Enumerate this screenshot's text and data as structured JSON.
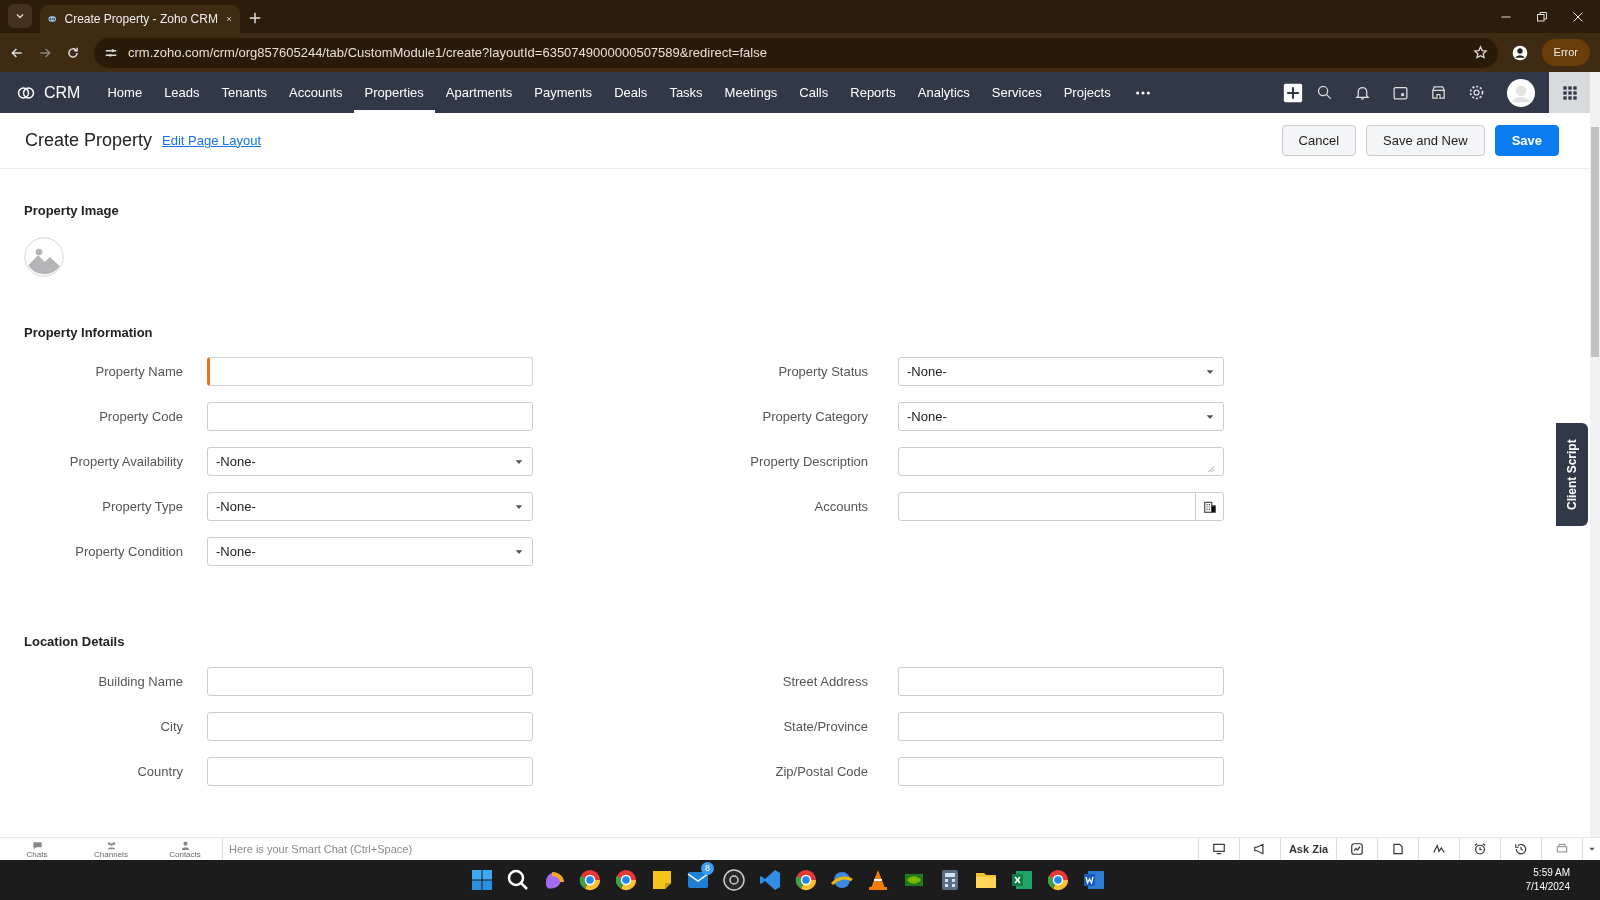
{
  "browser": {
    "tab_title": "Create Property - Zoho CRM",
    "url": "crm.zoho.com/crm/org857605244/tab/CustomModule1/create?layoutId=6350749000000507589&redirect=false",
    "profile_button": "Error"
  },
  "app_nav": {
    "brand": "CRM",
    "items": [
      {
        "label": "Home",
        "selected": false
      },
      {
        "label": "Leads",
        "selected": false
      },
      {
        "label": "Tenants",
        "selected": false
      },
      {
        "label": "Accounts",
        "selected": false
      },
      {
        "label": "Properties",
        "selected": true
      },
      {
        "label": "Apartments",
        "selected": false
      },
      {
        "label": "Payments",
        "selected": false
      },
      {
        "label": "Deals",
        "selected": false
      },
      {
        "label": "Tasks",
        "selected": false
      },
      {
        "label": "Meetings",
        "selected": false
      },
      {
        "label": "Calls",
        "selected": false
      },
      {
        "label": "Reports",
        "selected": false
      },
      {
        "label": "Analytics",
        "selected": false
      },
      {
        "label": "Services",
        "selected": false
      },
      {
        "label": "Projects",
        "selected": false
      }
    ]
  },
  "header": {
    "title": "Create Property",
    "link": "Edit Page Layout",
    "buttons": [
      {
        "label": "Cancel",
        "kind": "secondary"
      },
      {
        "label": "Save and New",
        "kind": "secondary"
      },
      {
        "label": "Save",
        "kind": "primary"
      }
    ]
  },
  "sections": [
    {
      "title": "Property Image",
      "kind": "image"
    },
    {
      "title": "Property Information",
      "kind": "fields",
      "left": [
        {
          "label": "Property Name",
          "kind": "text",
          "focused": true
        },
        {
          "label": "Property Code",
          "kind": "text",
          "focused": false
        },
        {
          "label": "Property Availability",
          "kind": "select",
          "value": "-None-",
          "focused": false
        },
        {
          "label": "Property Type",
          "kind": "select",
          "value": "-None-",
          "focused": false
        },
        {
          "label": "Property Condition",
          "kind": "select",
          "value": "-None-",
          "focused": false
        }
      ],
      "right": [
        {
          "label": "Property Status",
          "kind": "select",
          "value": "-None-",
          "focused": false
        },
        {
          "label": "Property Category",
          "kind": "select",
          "value": "-None-",
          "focused": false
        },
        {
          "label": "Property Description",
          "kind": "textarea",
          "focused": false
        },
        {
          "label": "Accounts",
          "kind": "lookup",
          "focused": false
        }
      ]
    },
    {
      "title": "Location Details",
      "kind": "fields",
      "left": [
        {
          "label": "Building Name",
          "kind": "text",
          "focused": false
        },
        {
          "label": "City",
          "kind": "text",
          "focused": false
        },
        {
          "label": "Country",
          "kind": "text",
          "focused": false
        }
      ],
      "right": [
        {
          "label": "Street Address",
          "kind": "text",
          "focused": false
        },
        {
          "label": "State/Province",
          "kind": "text",
          "focused": false
        },
        {
          "label": "Zip/Postal Code",
          "kind": "text",
          "focused": false
        }
      ]
    }
  ],
  "client_script_tab": "Client Script",
  "chat_bar": {
    "tabs": [
      "Chats",
      "Channels",
      "Contacts"
    ],
    "placeholder": "Here is your Smart Chat (Ctrl+Space)",
    "ask_zia": "Ask Zia"
  },
  "taskbar": {
    "badge": "8",
    "time": "5:59 AM",
    "date": "7/14/2024"
  }
}
